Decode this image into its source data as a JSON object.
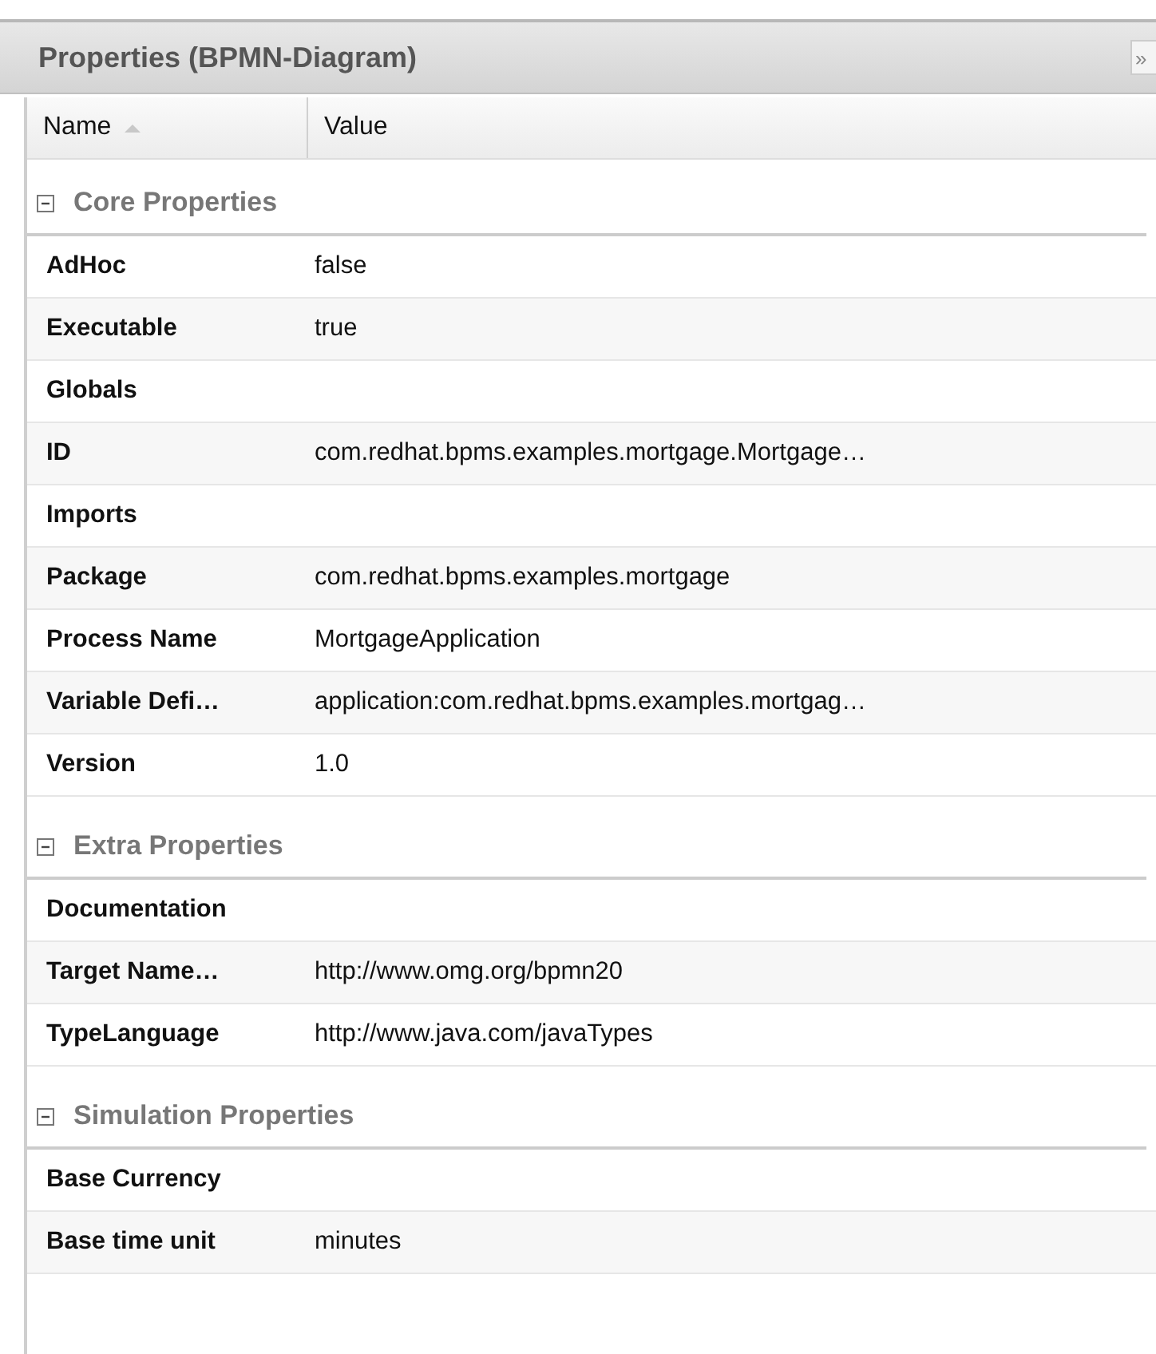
{
  "panel": {
    "title": "Properties (BPMN-Diagram)",
    "collapse_button": "»"
  },
  "columns": [
    {
      "label": "Name",
      "sorted": true
    },
    {
      "label": "Value",
      "sorted": false
    }
  ],
  "groups": [
    {
      "title": "Core Properties",
      "expanded": true,
      "rows": [
        {
          "name": "AdHoc",
          "value": "false"
        },
        {
          "name": "Executable",
          "value": "true"
        },
        {
          "name": "Globals"
        },
        {
          "name": "ID",
          "value": "com.redhat.bpms.examples.mortgage.Mortgage…"
        },
        {
          "name": "Imports"
        },
        {
          "name": "Package",
          "value": "com.redhat.bpms.examples.mortgage"
        },
        {
          "name": "Process Name",
          "value": "MortgageApplication"
        },
        {
          "name": "Variable Defi…",
          "value": "application:com.redhat.bpms.examples.mortgag…"
        },
        {
          "name": "Version",
          "value": "1.0"
        }
      ]
    },
    {
      "title": "Extra Properties",
      "expanded": true,
      "rows": [
        {
          "name": "Documentation"
        },
        {
          "name": "Target Name…",
          "value": "http://www.omg.org/bpmn20"
        },
        {
          "name": "TypeLanguage",
          "value": "http://www.java.com/javaTypes"
        }
      ]
    },
    {
      "title": "Simulation Properties",
      "expanded": true,
      "rows": [
        {
          "name": "Base Currency"
        },
        {
          "name": "Base time unit",
          "value": "minutes"
        }
      ]
    }
  ]
}
